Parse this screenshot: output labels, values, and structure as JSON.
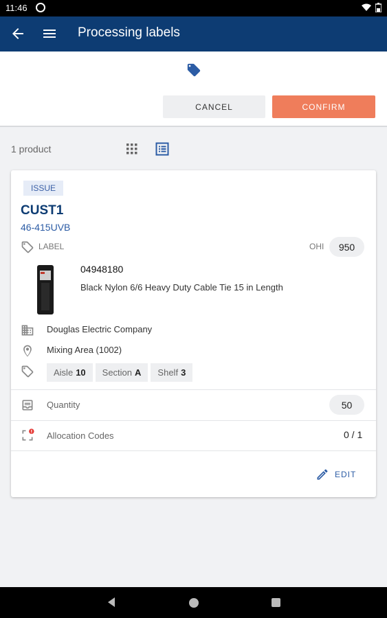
{
  "status_bar": {
    "time": "11:46"
  },
  "app_bar": {
    "title": "Processing labels"
  },
  "actions": {
    "cancel_label": "CANCEL",
    "confirm_label": "CONFIRM"
  },
  "list": {
    "count_label": "1 product"
  },
  "card": {
    "badge": "ISSUE",
    "customer": "CUST1",
    "part_number": "46-415UVB",
    "label_text": "LABEL",
    "ohi_label": "OHI",
    "ohi_value": "950",
    "sku": "04948180",
    "description": "Black Nylon 6/6 Heavy Duty Cable Tie 15 in Length",
    "supplier": "Douglas Electric Company",
    "location": "Mixing Area (1002)",
    "chips": [
      {
        "label": "Aisle",
        "value": "10"
      },
      {
        "label": "Section",
        "value": "A"
      },
      {
        "label": "Shelf",
        "value": "3"
      }
    ],
    "quantity_label": "Quantity",
    "quantity_value": "50",
    "allocation_label": "Allocation Codes",
    "allocation_value": "0 / 1",
    "edit_label": "EDIT"
  },
  "colors": {
    "primary": "#0d3c73",
    "accent": "#ef7d5b",
    "link": "#2c5ca5"
  }
}
